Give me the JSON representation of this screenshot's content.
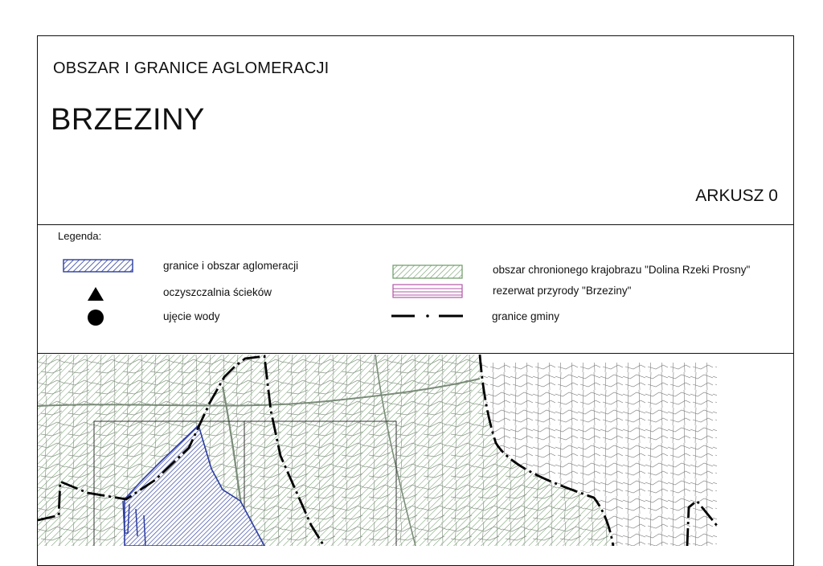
{
  "header": {
    "subtitle": "OBSZAR I GRANICE AGLOMERACJI",
    "title": "BRZEZINY",
    "sheet_label": "ARKUSZ 0"
  },
  "legend": {
    "title": "Legenda:",
    "items_left": [
      {
        "label": "granice i obszar aglomeracji",
        "icon": "blue-hatched-rectangle-icon"
      },
      {
        "label": "oczyszczalnia ścieków",
        "icon": "triangle-icon"
      },
      {
        "label": "ujęcie wody",
        "icon": "circle-icon"
      }
    ],
    "items_right": [
      {
        "label": "obszar chronionego krajobrazu \"Dolina Rzeki Prosny\"",
        "icon": "green-hatched-rectangle-icon"
      },
      {
        "label": "rezerwat przyrody \"Brzeziny\"",
        "icon": "pink-striped-rectangle-icon"
      },
      {
        "label": "granice gminy",
        "icon": "dash-dot-line-icon"
      }
    ]
  },
  "colors": {
    "agglomeration": "#2b3c9e",
    "protected_landscape": "#5e8a5a",
    "reserve": "#a0449a",
    "boundary": "#111111",
    "map_lines": "#6f6f6f"
  }
}
